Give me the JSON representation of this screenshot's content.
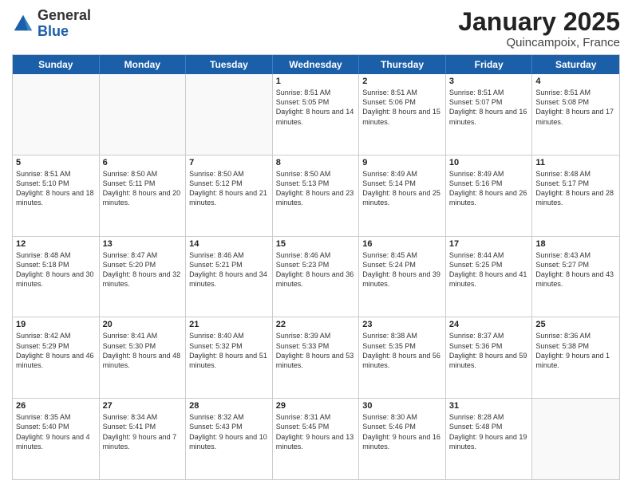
{
  "logo": {
    "general": "General",
    "blue": "Blue"
  },
  "header": {
    "month_title": "January 2025",
    "location": "Quincampoix, France"
  },
  "day_headers": [
    "Sunday",
    "Monday",
    "Tuesday",
    "Wednesday",
    "Thursday",
    "Friday",
    "Saturday"
  ],
  "weeks": [
    [
      {
        "num": "",
        "info": ""
      },
      {
        "num": "",
        "info": ""
      },
      {
        "num": "",
        "info": ""
      },
      {
        "num": "1",
        "info": "Sunrise: 8:51 AM\nSunset: 5:05 PM\nDaylight: 8 hours\nand 14 minutes."
      },
      {
        "num": "2",
        "info": "Sunrise: 8:51 AM\nSunset: 5:06 PM\nDaylight: 8 hours\nand 15 minutes."
      },
      {
        "num": "3",
        "info": "Sunrise: 8:51 AM\nSunset: 5:07 PM\nDaylight: 8 hours\nand 16 minutes."
      },
      {
        "num": "4",
        "info": "Sunrise: 8:51 AM\nSunset: 5:08 PM\nDaylight: 8 hours\nand 17 minutes."
      }
    ],
    [
      {
        "num": "5",
        "info": "Sunrise: 8:51 AM\nSunset: 5:10 PM\nDaylight: 8 hours\nand 18 minutes."
      },
      {
        "num": "6",
        "info": "Sunrise: 8:50 AM\nSunset: 5:11 PM\nDaylight: 8 hours\nand 20 minutes."
      },
      {
        "num": "7",
        "info": "Sunrise: 8:50 AM\nSunset: 5:12 PM\nDaylight: 8 hours\nand 21 minutes."
      },
      {
        "num": "8",
        "info": "Sunrise: 8:50 AM\nSunset: 5:13 PM\nDaylight: 8 hours\nand 23 minutes."
      },
      {
        "num": "9",
        "info": "Sunrise: 8:49 AM\nSunset: 5:14 PM\nDaylight: 8 hours\nand 25 minutes."
      },
      {
        "num": "10",
        "info": "Sunrise: 8:49 AM\nSunset: 5:16 PM\nDaylight: 8 hours\nand 26 minutes."
      },
      {
        "num": "11",
        "info": "Sunrise: 8:48 AM\nSunset: 5:17 PM\nDaylight: 8 hours\nand 28 minutes."
      }
    ],
    [
      {
        "num": "12",
        "info": "Sunrise: 8:48 AM\nSunset: 5:18 PM\nDaylight: 8 hours\nand 30 minutes."
      },
      {
        "num": "13",
        "info": "Sunrise: 8:47 AM\nSunset: 5:20 PM\nDaylight: 8 hours\nand 32 minutes."
      },
      {
        "num": "14",
        "info": "Sunrise: 8:46 AM\nSunset: 5:21 PM\nDaylight: 8 hours\nand 34 minutes."
      },
      {
        "num": "15",
        "info": "Sunrise: 8:46 AM\nSunset: 5:23 PM\nDaylight: 8 hours\nand 36 minutes."
      },
      {
        "num": "16",
        "info": "Sunrise: 8:45 AM\nSunset: 5:24 PM\nDaylight: 8 hours\nand 39 minutes."
      },
      {
        "num": "17",
        "info": "Sunrise: 8:44 AM\nSunset: 5:25 PM\nDaylight: 8 hours\nand 41 minutes."
      },
      {
        "num": "18",
        "info": "Sunrise: 8:43 AM\nSunset: 5:27 PM\nDaylight: 8 hours\nand 43 minutes."
      }
    ],
    [
      {
        "num": "19",
        "info": "Sunrise: 8:42 AM\nSunset: 5:29 PM\nDaylight: 8 hours\nand 46 minutes."
      },
      {
        "num": "20",
        "info": "Sunrise: 8:41 AM\nSunset: 5:30 PM\nDaylight: 8 hours\nand 48 minutes."
      },
      {
        "num": "21",
        "info": "Sunrise: 8:40 AM\nSunset: 5:32 PM\nDaylight: 8 hours\nand 51 minutes."
      },
      {
        "num": "22",
        "info": "Sunrise: 8:39 AM\nSunset: 5:33 PM\nDaylight: 8 hours\nand 53 minutes."
      },
      {
        "num": "23",
        "info": "Sunrise: 8:38 AM\nSunset: 5:35 PM\nDaylight: 8 hours\nand 56 minutes."
      },
      {
        "num": "24",
        "info": "Sunrise: 8:37 AM\nSunset: 5:36 PM\nDaylight: 8 hours\nand 59 minutes."
      },
      {
        "num": "25",
        "info": "Sunrise: 8:36 AM\nSunset: 5:38 PM\nDaylight: 9 hours\nand 1 minute."
      }
    ],
    [
      {
        "num": "26",
        "info": "Sunrise: 8:35 AM\nSunset: 5:40 PM\nDaylight: 9 hours\nand 4 minutes."
      },
      {
        "num": "27",
        "info": "Sunrise: 8:34 AM\nSunset: 5:41 PM\nDaylight: 9 hours\nand 7 minutes."
      },
      {
        "num": "28",
        "info": "Sunrise: 8:32 AM\nSunset: 5:43 PM\nDaylight: 9 hours\nand 10 minutes."
      },
      {
        "num": "29",
        "info": "Sunrise: 8:31 AM\nSunset: 5:45 PM\nDaylight: 9 hours\nand 13 minutes."
      },
      {
        "num": "30",
        "info": "Sunrise: 8:30 AM\nSunset: 5:46 PM\nDaylight: 9 hours\nand 16 minutes."
      },
      {
        "num": "31",
        "info": "Sunrise: 8:28 AM\nSunset: 5:48 PM\nDaylight: 9 hours\nand 19 minutes."
      },
      {
        "num": "",
        "info": ""
      }
    ]
  ]
}
